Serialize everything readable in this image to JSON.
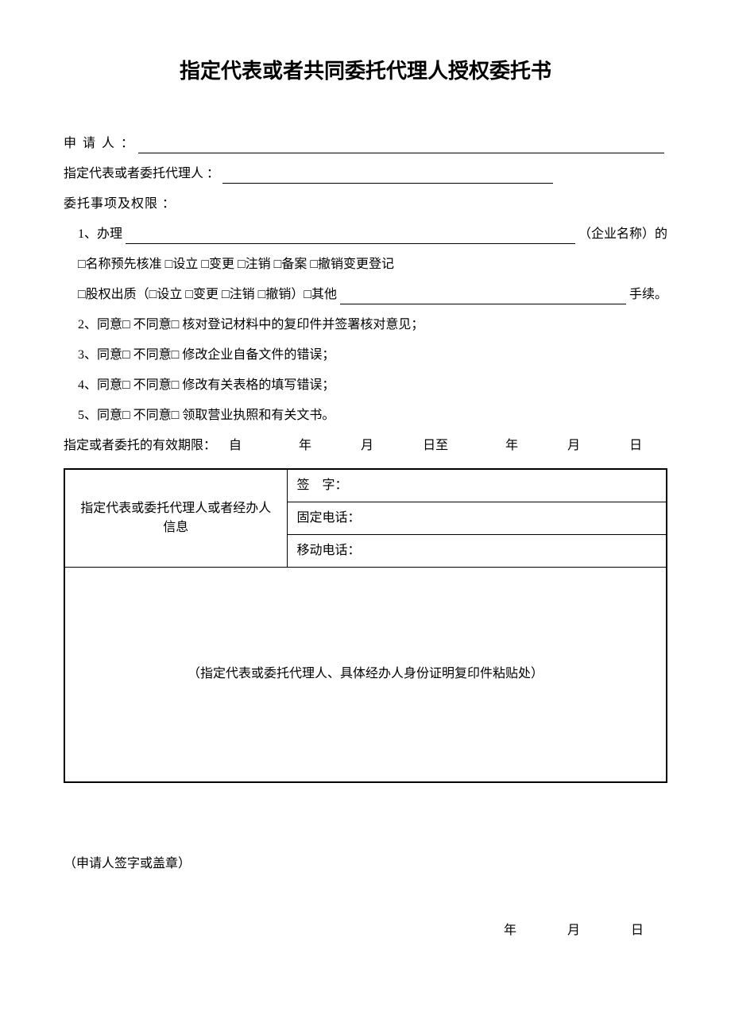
{
  "title": "指定代表或者共同委托代理人授权委托书",
  "applicant_label": "申 请 人 ：",
  "agent_label": "指定代表或者委托代理人 ：",
  "matters_label": "委托事项及权限 ：",
  "item1_prefix": "1、办理",
  "item1_suffix": "（企业名称）的",
  "item1_options": "□名称预先核准  □设立  □变更  □注销  □备案  □撤销变更登记",
  "item1_equity_prefix": "□股权出质（□设立  □变更  □注销  □撤销）□其他",
  "item1_equity_suffix": "手续。",
  "item2": "2、同意□  不同意□  核对登记材料中的复印件并签署核对意见；",
  "item3": "3、同意□  不同意□  修改企业自备文件的错误；",
  "item4": "4、同意□  不同意□  修改有关表格的填写错误；",
  "item5": "5、同意□  不同意□  领取营业执照和有关文书。",
  "validity_label": "指定或者委托的有效期限：",
  "from": "自",
  "year": "年",
  "month": "月",
  "day_to": "日至",
  "day": "日",
  "info_header": "指定代表或委托代理人或者经办人信息",
  "sign_label": "签　字：",
  "phone_label": "固定电话：",
  "mobile_label": "移动电话：",
  "paste_note": "（指定代表或委托代理人、具体经办人身份证明复印件粘贴处）",
  "signature_note": "（申请人签字或盖章）",
  "footer_year": "年",
  "footer_month": "月",
  "footer_day": "日"
}
